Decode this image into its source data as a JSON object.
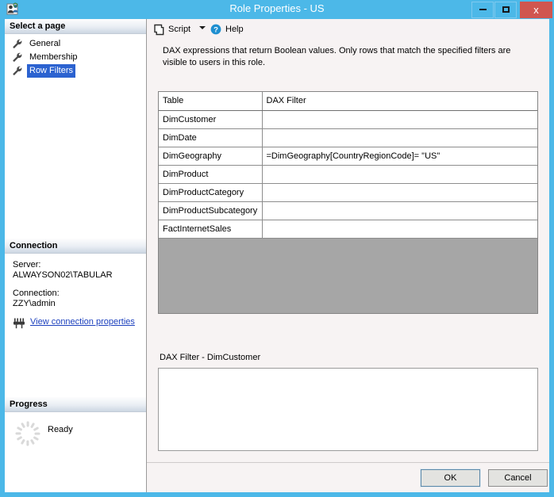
{
  "window": {
    "title": "Role Properties - US",
    "icon": "role-users-icon",
    "minimize_label": "Minimize",
    "maximize_label": "Maximize",
    "close_label": "x",
    "titlebar_color": "#4cb8e8",
    "close_color": "#d0564f"
  },
  "sidebar": {
    "pages_header": "Select a page",
    "items": [
      {
        "label": "General",
        "icon": "wrench-icon",
        "selected": false
      },
      {
        "label": "Membership",
        "icon": "wrench-icon",
        "selected": false
      },
      {
        "label": "Row Filters",
        "icon": "wrench-icon",
        "selected": true
      }
    ],
    "selection_color": "#2b62d0",
    "connection": {
      "header": "Connection",
      "server_label": "Server:",
      "server_value": "ALWAYSON02\\TABULAR",
      "connection_label": "Connection:",
      "connection_value": "ZZY\\admin",
      "link_text": "View connection properties",
      "link_icon": "plug-connector-icon",
      "link_color": "#1b3fbd"
    },
    "progress": {
      "header": "Progress",
      "status": "Ready",
      "icon": "spinner-icon"
    }
  },
  "toolbar": {
    "script_label": "Script",
    "script_icon": "script-document-icon",
    "dropdown_icon": "chevron-down-icon",
    "help_label": "Help",
    "help_icon": "help-question-icon"
  },
  "main": {
    "description": "DAX expressions that return Boolean values. Only rows that match the specified filters are visible to users in this role.",
    "grid": {
      "columns": [
        "Table",
        "DAX Filter"
      ],
      "rows": [
        {
          "table": "DimCustomer",
          "filter": ""
        },
        {
          "table": "DimDate",
          "filter": ""
        },
        {
          "table": "DimGeography",
          "filter": "=DimGeography[CountryRegionCode]= \"US\""
        },
        {
          "table": "DimProduct",
          "filter": ""
        },
        {
          "table": "DimProductCategory",
          "filter": ""
        },
        {
          "table": "DimProductSubcategory",
          "filter": ""
        },
        {
          "table": "FactInternetSales",
          "filter": ""
        }
      ],
      "filler_color": "#a6a6a6"
    },
    "editor": {
      "label": "DAX Filter - DimCustomer",
      "value": "",
      "placeholder": ""
    }
  },
  "footer": {
    "ok_label": "OK",
    "cancel_label": "Cancel"
  }
}
